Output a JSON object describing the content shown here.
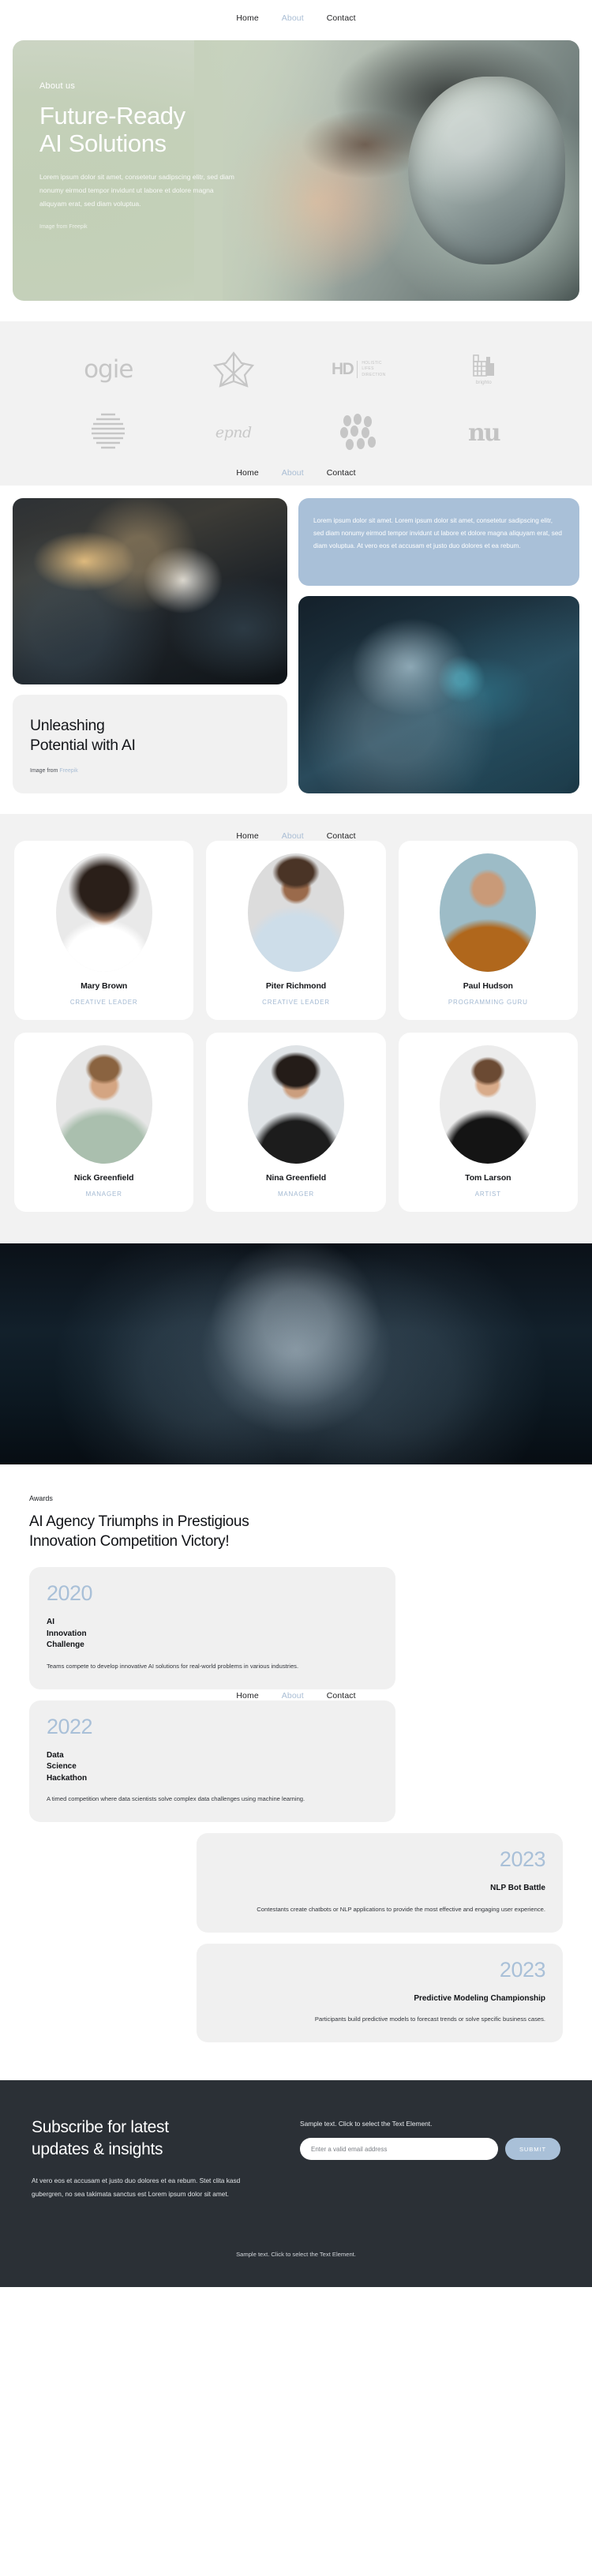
{
  "nav": {
    "items": [
      {
        "label": "Home",
        "muted": false
      },
      {
        "label": "About",
        "muted": true
      },
      {
        "label": "Contact",
        "muted": false
      }
    ]
  },
  "hero": {
    "eyebrow": "About us",
    "title": "Future-Ready\nAI Solutions",
    "body": "Lorem ipsum dolor sit amet, consetetur sadipscing elitr, sed diam nonumy eirmod tempor invidunt ut labore et dolore magna aliquyam erat, sed diam voluptua.",
    "credit": "Image from Freepik",
    "bg_color": "#c4d0b9"
  },
  "logos": [
    {
      "name": "ogie",
      "text": "ogie"
    },
    {
      "name": "flower-mark",
      "text": ""
    },
    {
      "name": "holistic-lifes-direction",
      "text": "HD",
      "sub": "HOLISTIC\nLIFES\nDIRECTION"
    },
    {
      "name": "brighto",
      "text": "brighto"
    },
    {
      "name": "striped-sphere",
      "text": ""
    },
    {
      "name": "epnd",
      "text": "epnd"
    },
    {
      "name": "dots-mark",
      "text": ""
    },
    {
      "name": "nu",
      "text": "nu"
    }
  ],
  "showcase": {
    "blue_card_text": "Lorem ipsum dolor sit amet. Lorem ipsum dolor sit amet, consetetur sadipscing elitr, sed diam nonumy eirmod tempor invidunt ut labore et dolore magna aliquyam erat, sed diam voluptua. At vero eos et accusam et justo duo dolores et ea rebum.",
    "blue_card_color": "#a9c0d8",
    "unleash_title": "Unleashing\nPotential with AI",
    "unleash_credit_prefix": "Image from ",
    "unleash_credit_link": "Freepik"
  },
  "team": [
    {
      "name": "Mary Brown",
      "role": "CREATIVE LEADER"
    },
    {
      "name": "Piter Richmond",
      "role": "CREATIVE LEADER"
    },
    {
      "name": "Paul Hudson",
      "role": "PROGRAMMING GURU"
    },
    {
      "name": "Nick Greenfield",
      "role": "MANAGER"
    },
    {
      "name": "Nina Greenfield",
      "role": "MANAGER"
    },
    {
      "name": "Tom Larson",
      "role": "ARTIST"
    }
  ],
  "awards": {
    "eyebrow": "Awards",
    "title": "AI Agency Triumphs in Prestigious\nInnovation Competition Victory!",
    "year_color": "#a9c0d8",
    "timeline": [
      {
        "year": "2020",
        "name": "AI\nInnovation\nChallenge",
        "desc": "Teams compete to develop innovative AI solutions for real-world problems in various industries.",
        "align": "left"
      },
      {
        "year": "2022",
        "name": "Data\nScience\nHackathon",
        "desc": "A timed competition where data scientists solve complex data challenges using machine learning.",
        "align": "left"
      },
      {
        "year": "2023",
        "name": "NLP Bot Battle",
        "desc": "Contestants create chatbots or NLP applications to provide the most effective and engaging user experience.",
        "align": "right"
      },
      {
        "year": "2023",
        "name": "Predictive Modeling Championship",
        "desc": "Participants build predictive models to forecast trends or solve specific business cases.",
        "align": "right"
      }
    ]
  },
  "footer": {
    "title": "Subscribe for latest\nupdates & insights",
    "body": "At vero eos et accusam et justo duo dolores et ea rebum. Stet clita kasd gubergren, no sea takimata sanctus est Lorem ipsum dolor sit amet.",
    "sample_text": "Sample text. Click to select the Text Element.",
    "email_placeholder": "Enter a valid email address",
    "submit_label": "SUBMIT",
    "bottom_text": "Sample text. Click to select the Text Element.",
    "bg_color": "#2b3036",
    "accent_color": "#a9c0d8"
  }
}
